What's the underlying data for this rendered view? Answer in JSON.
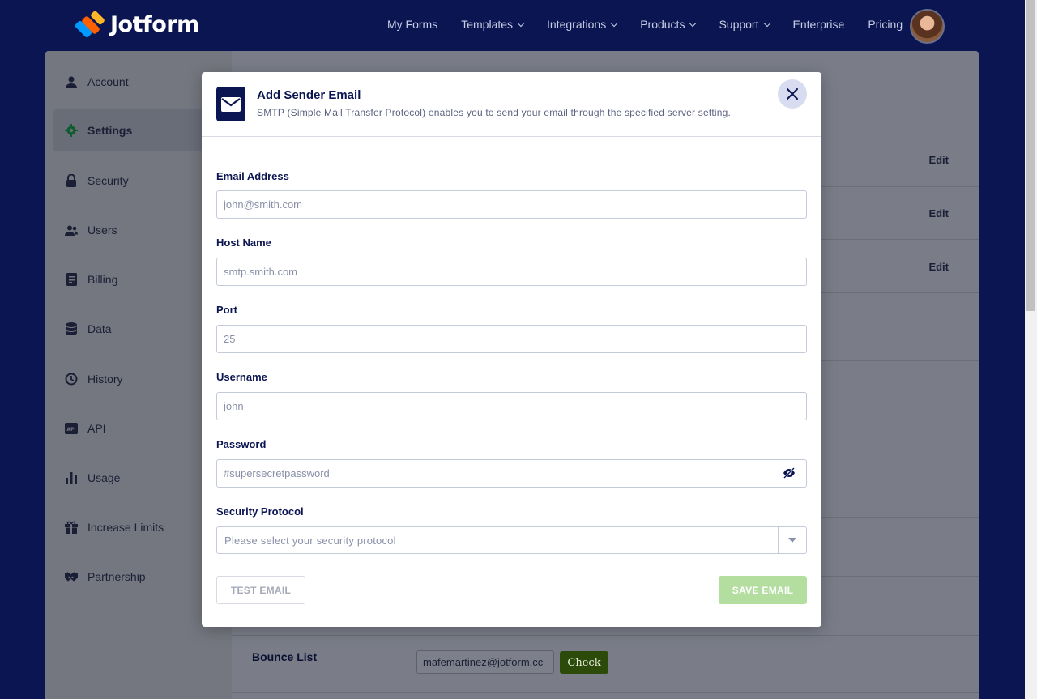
{
  "brand": {
    "name": "Jotform"
  },
  "nav": {
    "links": [
      {
        "label": "My Forms",
        "dropdown": false
      },
      {
        "label": "Templates",
        "dropdown": true
      },
      {
        "label": "Integrations",
        "dropdown": true
      },
      {
        "label": "Products",
        "dropdown": true
      },
      {
        "label": "Support",
        "dropdown": true
      },
      {
        "label": "Enterprise",
        "dropdown": false
      },
      {
        "label": "Pricing",
        "dropdown": false
      }
    ]
  },
  "sidebar": {
    "items": [
      {
        "label": "Account",
        "icon": "user-icon",
        "active": false
      },
      {
        "label": "Settings",
        "icon": "gear-icon",
        "active": true
      },
      {
        "label": "Security",
        "icon": "lock-icon",
        "active": false
      },
      {
        "label": "Users",
        "icon": "users-icon",
        "active": false
      },
      {
        "label": "Billing",
        "icon": "receipt-icon",
        "active": false
      },
      {
        "label": "Data",
        "icon": "database-icon",
        "active": false
      },
      {
        "label": "History",
        "icon": "history-icon",
        "active": false
      },
      {
        "label": "API",
        "icon": "api-icon",
        "active": false
      },
      {
        "label": "Usage",
        "icon": "bar-chart-icon",
        "active": false
      },
      {
        "label": "Increase Limits",
        "icon": "gift-icon",
        "active": false
      },
      {
        "label": "Partnership",
        "icon": "handshake-icon",
        "active": false
      }
    ]
  },
  "content": {
    "edit_label": "Edit",
    "bounce_list": {
      "label": "Bounce List",
      "value": "mafemartinez@jotform.cc",
      "check_label": "Check"
    }
  },
  "modal": {
    "title": "Add Sender Email",
    "subtitle": "SMTP (Simple Mail Transfer Protocol) enables you to send your email through the specified server setting.",
    "fields": {
      "email": {
        "label": "Email Address",
        "placeholder": "john@smith.com"
      },
      "host": {
        "label": "Host Name",
        "placeholder": "smtp.smith.com"
      },
      "port": {
        "label": "Port",
        "placeholder": "25"
      },
      "username": {
        "label": "Username",
        "placeholder": "john"
      },
      "password": {
        "label": "Password",
        "placeholder": "#supersecretpassword"
      },
      "protocol": {
        "label": "Security Protocol",
        "placeholder": "Please select your security protocol"
      }
    },
    "test_button": "TEST EMAIL",
    "save_button": "SAVE EMAIL"
  },
  "colors": {
    "navy": "#0a1551",
    "save_disabled": "#b4dea0",
    "check_button": "#2c4a0a"
  }
}
